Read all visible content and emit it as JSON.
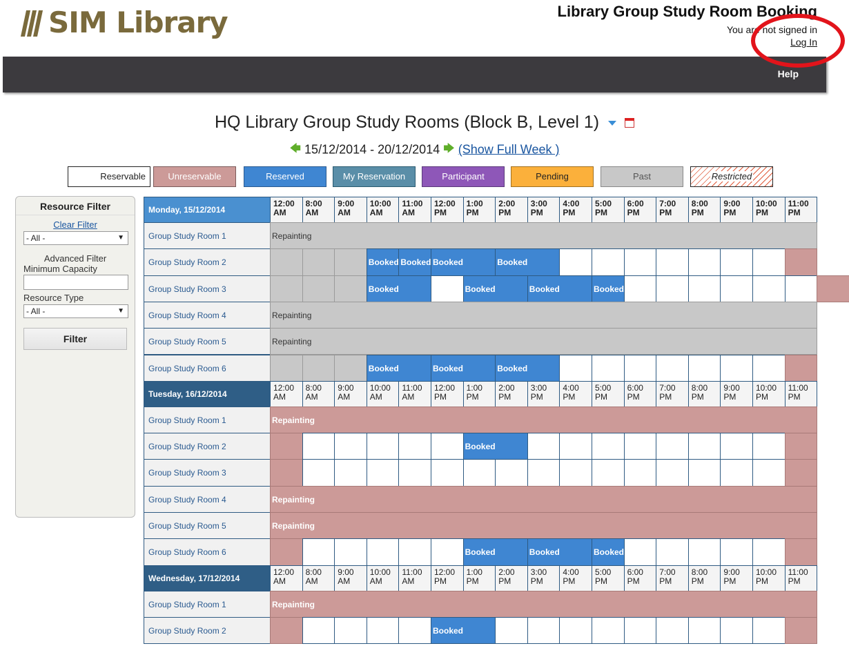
{
  "brand": {
    "name": "SIM Library"
  },
  "header": {
    "title": "Library Group Study Room Booking",
    "signin_status": "You are not signed in",
    "login_label": "Log In"
  },
  "nav": {
    "help_label": "Help"
  },
  "page": {
    "title": "HQ Library Group Study Rooms (Block B, Level 1)",
    "date_range": "15/12/2014 - 20/12/2014",
    "show_full_week": "(Show Full Week )"
  },
  "icons": {
    "filter": "filter-icon",
    "calendar": "calendar-icon",
    "prev": "left-arrow-icon",
    "next": "right-arrow-icon"
  },
  "colors": {
    "reserved": "#3f86d2",
    "unreservable": "#cc9a98",
    "past": "#c8c8c8",
    "my_reservation": "#5a8ea8",
    "participant": "#8e57b8",
    "pending": "#fbb03b",
    "header_current": "#4a90d0",
    "header_other": "#2f5e86",
    "grid_border": "#2e5a82",
    "alert_circle": "#e2141b"
  },
  "legend": [
    {
      "label": "Reservable",
      "bg": "#ffffff",
      "fg": "#222222",
      "border": "#222222"
    },
    {
      "label": "Unreservable",
      "bg": "#cc9a98",
      "fg": "#ffffff",
      "border": "#7a5a5a"
    },
    {
      "label": "Reserved",
      "bg": "#3f86d2",
      "fg": "#ffffff",
      "border": "#2a5a90"
    },
    {
      "label": "My Reservation",
      "bg": "#5a8ea8",
      "fg": "#ffffff",
      "border": "#2a5a70"
    },
    {
      "label": "Participant",
      "bg": "#8e57b8",
      "fg": "#ffffff",
      "border": "#5a3a7a"
    },
    {
      "label": "Pending",
      "bg": "#fbb03b",
      "fg": "#222222",
      "border": "#a07020"
    },
    {
      "label": "Past",
      "bg": "#c8c8c8",
      "fg": "#555555",
      "border": "#888888"
    },
    {
      "label": "Restricted",
      "bg": "hatched",
      "fg": "#222222",
      "border": "#222222"
    }
  ],
  "sidebar": {
    "title": "Resource Filter",
    "clear_filter": "Clear Filter",
    "resource_select": "- All -",
    "advanced_filter": "Advanced Filter",
    "min_capacity_label": "Minimum Capacity",
    "min_capacity_value": "",
    "resource_type_label": "Resource Type",
    "resource_type_select": "- All -",
    "filter_button": "Filter"
  },
  "times": [
    {
      "t": "12:00",
      "p": "AM"
    },
    {
      "t": "8:00",
      "p": "AM"
    },
    {
      "t": "9:00",
      "p": "AM"
    },
    {
      "t": "10:00",
      "p": "AM"
    },
    {
      "t": "11:00",
      "p": "AM"
    },
    {
      "t": "12:00",
      "p": "PM"
    },
    {
      "t": "1:00",
      "p": "PM"
    },
    {
      "t": "2:00",
      "p": "PM"
    },
    {
      "t": "3:00",
      "p": "PM"
    },
    {
      "t": "4:00",
      "p": "PM"
    },
    {
      "t": "5:00",
      "p": "PM"
    },
    {
      "t": "6:00",
      "p": "PM"
    },
    {
      "t": "7:00",
      "p": "PM"
    },
    {
      "t": "8:00",
      "p": "PM"
    },
    {
      "t": "9:00",
      "p": "PM"
    },
    {
      "t": "10:00",
      "p": "PM"
    },
    {
      "t": "11:00",
      "p": "PM"
    }
  ],
  "days": [
    {
      "label": "Monday, 15/12/2014",
      "current": true,
      "rooms": [
        {
          "name": "Group Study Room 1",
          "segments": [
            [
              "past",
              17,
              "Repainting"
            ]
          ]
        },
        {
          "name": "Group Study Room 2",
          "segments": [
            [
              "past",
              1,
              ""
            ],
            [
              "past",
              1,
              ""
            ],
            [
              "past",
              1,
              ""
            ],
            [
              "reserved",
              1,
              "Booked"
            ],
            [
              "reserved",
              1,
              "Booked"
            ],
            [
              "reserved",
              2,
              "Booked"
            ],
            [
              "reserved",
              2,
              "Booked"
            ],
            [
              "open",
              1,
              ""
            ],
            [
              "open",
              1,
              ""
            ],
            [
              "open",
              1,
              ""
            ],
            [
              "open",
              1,
              ""
            ],
            [
              "open",
              1,
              ""
            ],
            [
              "open",
              1,
              ""
            ],
            [
              "open",
              1,
              ""
            ],
            [
              "unres",
              1,
              ""
            ]
          ]
        },
        {
          "name": "Group Study Room 3",
          "segments": [
            [
              "past",
              1,
              ""
            ],
            [
              "past",
              1,
              ""
            ],
            [
              "past",
              1,
              ""
            ],
            [
              "reserved",
              2,
              "Booked"
            ],
            [
              "open",
              1,
              ""
            ],
            [
              "reserved",
              2,
              "Booked"
            ],
            [
              "reserved",
              2,
              "Booked"
            ],
            [
              "reserved",
              1,
              "Booked"
            ],
            [
              "open",
              1,
              ""
            ],
            [
              "open",
              1,
              ""
            ],
            [
              "open",
              1,
              ""
            ],
            [
              "open",
              1,
              ""
            ],
            [
              "open",
              1,
              ""
            ],
            [
              "open",
              1,
              ""
            ],
            [
              "unres",
              1,
              ""
            ]
          ]
        },
        {
          "name": "Group Study Room 4",
          "segments": [
            [
              "past",
              17,
              "Repainting"
            ]
          ]
        },
        {
          "name": "Group Study Room 5",
          "segments": [
            [
              "past",
              17,
              "Repainting"
            ]
          ]
        },
        {
          "name": "Group Study Room 6",
          "segments": [
            [
              "past",
              1,
              ""
            ],
            [
              "past",
              1,
              ""
            ],
            [
              "past",
              1,
              ""
            ],
            [
              "reserved",
              2,
              "Booked"
            ],
            [
              "reserved",
              2,
              "Booked"
            ],
            [
              "reserved",
              2,
              "Booked"
            ],
            [
              "open",
              1,
              ""
            ],
            [
              "open",
              1,
              ""
            ],
            [
              "open",
              1,
              ""
            ],
            [
              "open",
              1,
              ""
            ],
            [
              "open",
              1,
              ""
            ],
            [
              "open",
              1,
              ""
            ],
            [
              "open",
              1,
              ""
            ],
            [
              "unres",
              1,
              ""
            ]
          ]
        }
      ]
    },
    {
      "label": "Tuesday, 16/12/2014",
      "current": false,
      "rooms": [
        {
          "name": "Group Study Room 1",
          "segments": [
            [
              "unres",
              17,
              "Repainting"
            ]
          ]
        },
        {
          "name": "Group Study Room 2",
          "segments": [
            [
              "unres",
              1,
              ""
            ],
            [
              "open",
              1,
              ""
            ],
            [
              "open",
              1,
              ""
            ],
            [
              "open",
              1,
              ""
            ],
            [
              "open",
              1,
              ""
            ],
            [
              "open",
              1,
              ""
            ],
            [
              "reserved",
              2,
              "Booked"
            ],
            [
              "open",
              1,
              ""
            ],
            [
              "open",
              1,
              ""
            ],
            [
              "open",
              1,
              ""
            ],
            [
              "open",
              1,
              ""
            ],
            [
              "open",
              1,
              ""
            ],
            [
              "open",
              1,
              ""
            ],
            [
              "open",
              1,
              ""
            ],
            [
              "open",
              1,
              ""
            ],
            [
              "unres",
              1,
              ""
            ]
          ]
        },
        {
          "name": "Group Study Room 3",
          "segments": [
            [
              "unres",
              1,
              ""
            ],
            [
              "open",
              1,
              ""
            ],
            [
              "open",
              1,
              ""
            ],
            [
              "open",
              1,
              ""
            ],
            [
              "open",
              1,
              ""
            ],
            [
              "open",
              1,
              ""
            ],
            [
              "open",
              1,
              ""
            ],
            [
              "open",
              1,
              ""
            ],
            [
              "open",
              1,
              ""
            ],
            [
              "open",
              1,
              ""
            ],
            [
              "open",
              1,
              ""
            ],
            [
              "open",
              1,
              ""
            ],
            [
              "open",
              1,
              ""
            ],
            [
              "open",
              1,
              ""
            ],
            [
              "open",
              1,
              ""
            ],
            [
              "open",
              1,
              ""
            ],
            [
              "unres",
              1,
              ""
            ]
          ]
        },
        {
          "name": "Group Study Room 4",
          "segments": [
            [
              "unres",
              17,
              "Repainting"
            ]
          ]
        },
        {
          "name": "Group Study Room 5",
          "segments": [
            [
              "unres",
              17,
              "Repainting"
            ]
          ]
        },
        {
          "name": "Group Study Room 6",
          "segments": [
            [
              "unres",
              1,
              ""
            ],
            [
              "open",
              1,
              ""
            ],
            [
              "open",
              1,
              ""
            ],
            [
              "open",
              1,
              ""
            ],
            [
              "open",
              1,
              ""
            ],
            [
              "open",
              1,
              ""
            ],
            [
              "reserved",
              2,
              "Booked"
            ],
            [
              "reserved",
              2,
              "Booked"
            ],
            [
              "reserved",
              1,
              "Booked"
            ],
            [
              "open",
              1,
              ""
            ],
            [
              "open",
              1,
              ""
            ],
            [
              "open",
              1,
              ""
            ],
            [
              "open",
              1,
              ""
            ],
            [
              "open",
              1,
              ""
            ],
            [
              "unres",
              1,
              ""
            ]
          ]
        }
      ]
    },
    {
      "label": "Wednesday, 17/12/2014",
      "current": false,
      "rooms": [
        {
          "name": "Group Study Room 1",
          "segments": [
            [
              "unres",
              17,
              "Repainting"
            ]
          ]
        },
        {
          "name": "Group Study Room 2",
          "segments": [
            [
              "unres",
              1,
              ""
            ],
            [
              "open",
              1,
              ""
            ],
            [
              "open",
              1,
              ""
            ],
            [
              "open",
              1,
              ""
            ],
            [
              "open",
              1,
              ""
            ],
            [
              "reserved",
              2,
              "Booked"
            ],
            [
              "open",
              1,
              ""
            ],
            [
              "open",
              1,
              ""
            ],
            [
              "open",
              1,
              ""
            ],
            [
              "open",
              1,
              ""
            ],
            [
              "open",
              1,
              ""
            ],
            [
              "open",
              1,
              ""
            ],
            [
              "open",
              1,
              ""
            ],
            [
              "open",
              1,
              ""
            ],
            [
              "open",
              1,
              ""
            ],
            [
              "unres",
              1,
              ""
            ]
          ]
        }
      ]
    }
  ]
}
